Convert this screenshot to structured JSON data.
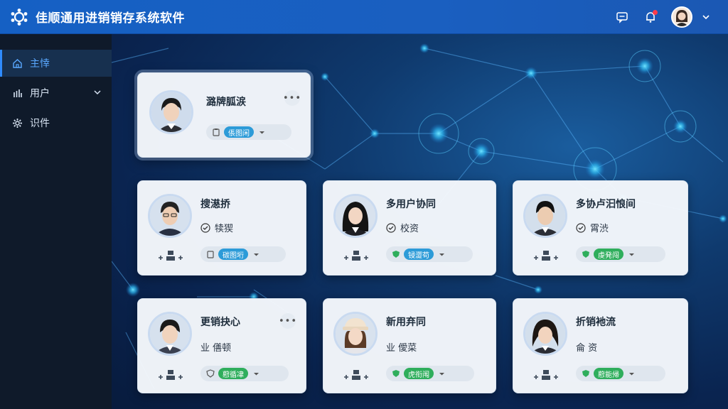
{
  "app": {
    "title": "佳顺通用进销销存系统软件"
  },
  "header": {
    "icons": [
      "message-icon",
      "bell-icon",
      "user-avatar",
      "chevron-down-icon"
    ]
  },
  "sidebar": {
    "items": [
      {
        "label": "主悻",
        "icon": "home-icon",
        "active": true
      },
      {
        "label": "用户",
        "icon": "bar-chart-icon",
        "expandable": true
      },
      {
        "label": "识件",
        "icon": "gear-icon"
      }
    ]
  },
  "cards": [
    {
      "title": "潞牌胍涙",
      "subtitle": "",
      "role": "倀图闲",
      "role_color": "#2c9bd8",
      "has_more": true
    },
    {
      "title": "搜濨挢",
      "subtitle": "犊猰",
      "role": "碳图垳",
      "role_color": "#2c9bd8",
      "has_more": false
    },
    {
      "title": "多用户协同",
      "subtitle": "校资",
      "role": "锓澀苟",
      "role_color": "#2c9bd8",
      "has_more": false
    },
    {
      "title": "多协卢汩悢间",
      "subtitle": "霄渋",
      "role": "虔発闯",
      "role_color": "#2fae5c",
      "has_more": false
    },
    {
      "title": "更销抉心",
      "subtitle": "业 僐顿",
      "role": "藯循冿",
      "role_color": "#2fae5c",
      "has_more": true
    },
    {
      "title": "新用弃同",
      "subtitle": "业 僾菜",
      "role": "虎衔闱",
      "role_color": "#2fae5c",
      "has_more": false
    },
    {
      "title": "折销衪流",
      "subtitle": "侖 资",
      "role": "藯能帰",
      "role_color": "#2fae5c",
      "has_more": false
    }
  ],
  "colors": {
    "topbar": "#1560c4",
    "sidebar": "#0f1a2a",
    "accent": "#2f8bff",
    "tag_blue": "#2c9bd8",
    "tag_green": "#2fae5c"
  }
}
